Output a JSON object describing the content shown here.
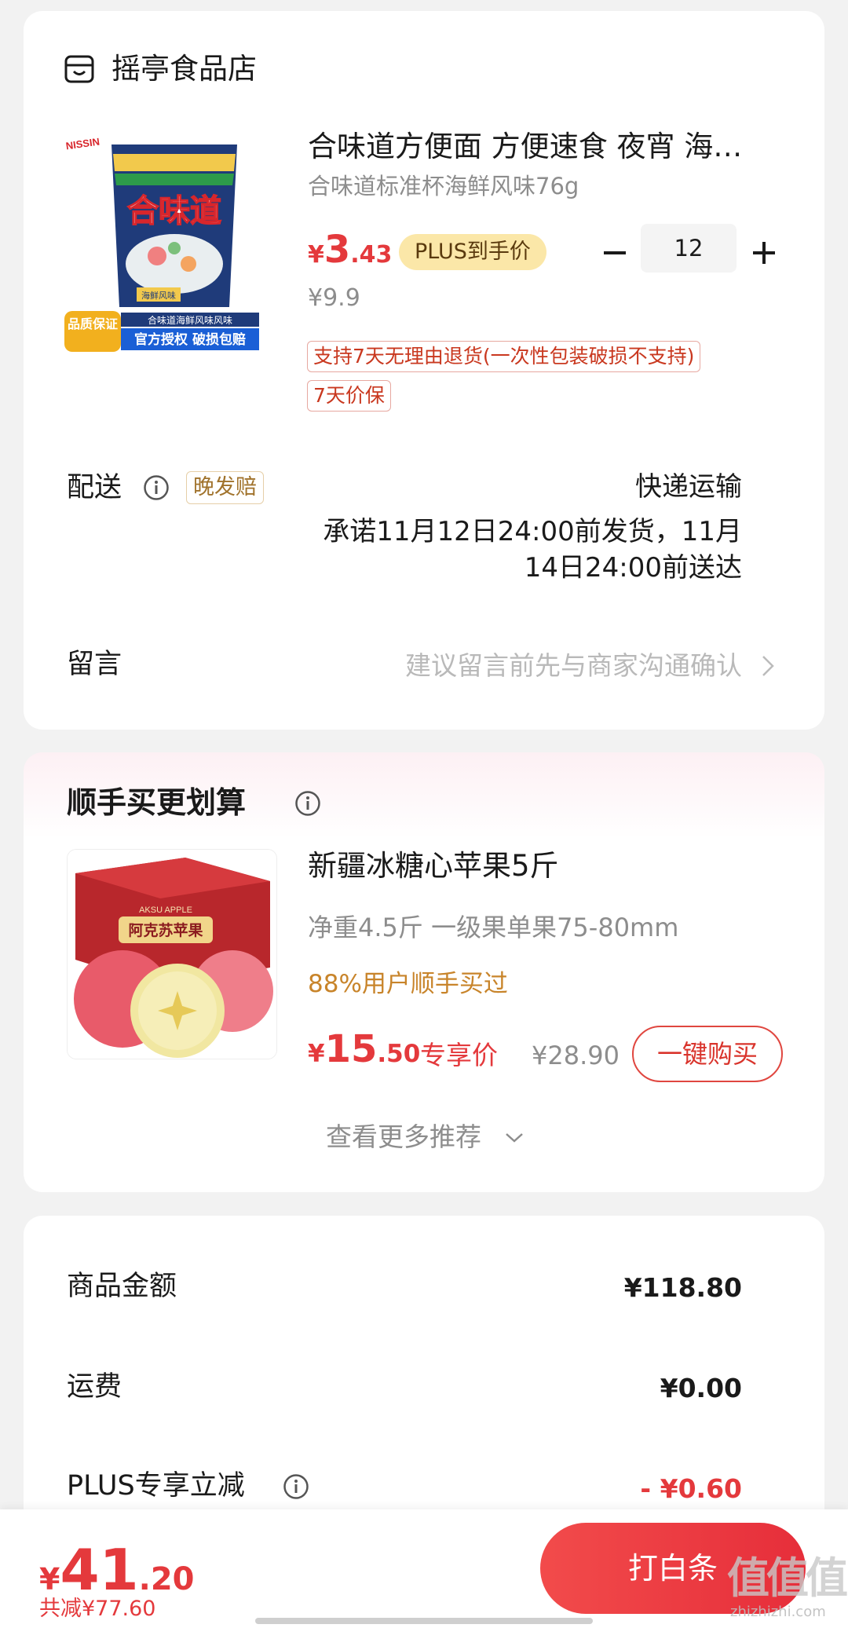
{
  "shop": {
    "name": "摇亭食品店",
    "product": {
      "title": "合味道方便面 方便速食 夜宵 海鲜风味杯面",
      "spec": "合味道标准杯海鲜风味76g",
      "price_symbol": "¥",
      "price_int": "3",
      "price_dec": ".43",
      "plus_badge": "PLUS到手价",
      "original_price": "¥9.9",
      "quantity": "12",
      "tags": [
        "支持7天无理由退货(一次性包装破损不支持)",
        "7天价保"
      ],
      "image_text": {
        "brand": "NISSIN",
        "name": "合味道",
        "flavor": "海鲜风味",
        "stripe": "合味道海鲜风味风味",
        "guarantee": "品质保证",
        "auth": "官方授权 破损包赔"
      }
    },
    "delivery": {
      "label": "配送",
      "late_tag": "晚发赔",
      "method": "快递运输",
      "promise": "承诺11月12日24:00前发货，11月14日24:00前送达"
    },
    "message": {
      "label": "留言",
      "hint": "建议留言前先与商家沟通确认"
    }
  },
  "recommend": {
    "title": "顺手买更划算",
    "item": {
      "name": "新疆冰糖心苹果5斤",
      "spec": "净重4.5斤 一级果单果75-80mm",
      "stat": "88%用户顺手买过",
      "price_symbol": "¥",
      "price_int": "15",
      "price_dec": ".50",
      "price_label": "专享价",
      "original_price": "¥28.90",
      "buy_label": "一键购买",
      "image_text": {
        "box_title": "阿克苏苹果",
        "box_sub": "AKSU APPLE"
      }
    },
    "more": "查看更多推荐"
  },
  "summary": {
    "rows": [
      {
        "label": "商品金额",
        "value": "¥118.80"
      },
      {
        "label": "运费",
        "value": "¥0.00"
      },
      {
        "label": "PLUS专享立减",
        "value": "- ¥0.60"
      }
    ]
  },
  "bottom": {
    "price_symbol": "¥",
    "price_int": "41",
    "price_dec": ".20",
    "saved": "共减¥77.60",
    "pay_label": "打白条",
    "watermark": "值值值",
    "watermark_sub": "zhizhizhi.com"
  },
  "colors": {
    "accent_red": "#e4393c",
    "plus_gold": "#fbe7a8",
    "stat_orange": "#c8842a"
  }
}
